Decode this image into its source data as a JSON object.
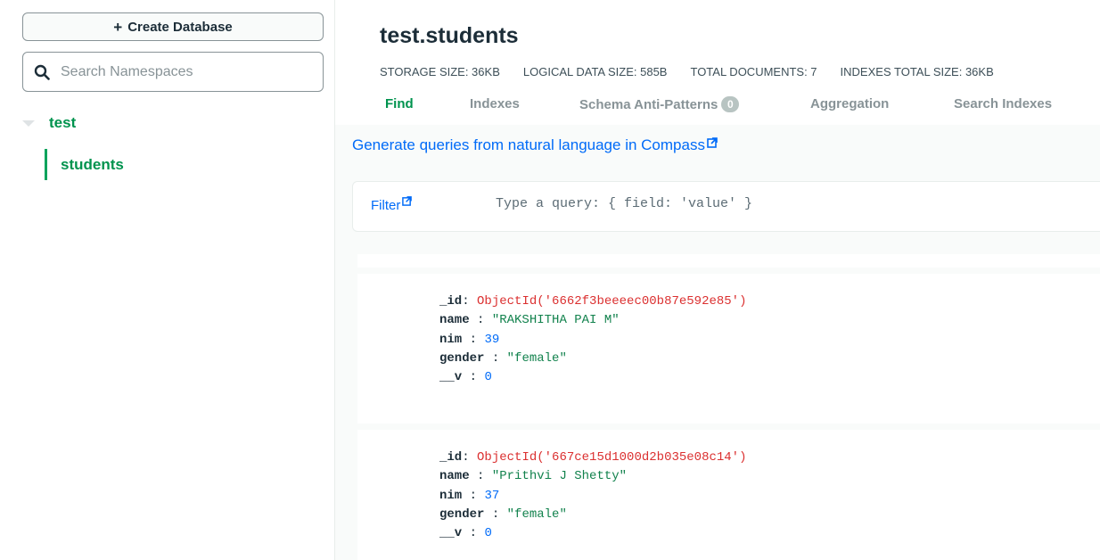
{
  "sidebar": {
    "create_label": "Create Database",
    "search_placeholder": "Search Namespaces",
    "database": "test",
    "collection": "students"
  },
  "header": {
    "title": "test.students",
    "stats": [
      "STORAGE SIZE: 36KB",
      "LOGICAL DATA SIZE: 585B",
      "TOTAL DOCUMENTS: 7",
      "INDEXES TOTAL SIZE: 36KB"
    ],
    "tabs": [
      {
        "label": "Find",
        "active": true
      },
      {
        "label": "Indexes"
      },
      {
        "label": "Schema Anti-Patterns",
        "badge": "0"
      },
      {
        "label": "Aggregation"
      },
      {
        "label": "Search Indexes"
      }
    ]
  },
  "nl_link": "Generate queries from natural language in Compass",
  "filter": {
    "label": "Filter",
    "placeholder": "Type a query: { field: 'value' }"
  },
  "documents": [
    {
      "fields": [
        {
          "key": "_id",
          "value": "ObjectId('6662f3beeeec00b87e592e85')",
          "type": "oid"
        },
        {
          "key": "name",
          "value": "\"RAKSHITHA PAI M\"",
          "type": "str"
        },
        {
          "key": "nim",
          "value": "39",
          "type": "num"
        },
        {
          "key": "gender",
          "value": "\"female\"",
          "type": "str"
        },
        {
          "key": "__v",
          "value": "0",
          "type": "num"
        }
      ]
    },
    {
      "fields": [
        {
          "key": "_id",
          "value": "ObjectId('667ce15d1000d2b035e08c14')",
          "type": "oid"
        },
        {
          "key": "name",
          "value": "\"Prithvi J Shetty\"",
          "type": "str"
        },
        {
          "key": "nim",
          "value": "37",
          "type": "num"
        },
        {
          "key": "gender",
          "value": "\"female\"",
          "type": "str"
        },
        {
          "key": "__v",
          "value": "0",
          "type": "num"
        }
      ]
    }
  ],
  "colors": {
    "accent_green": "#00934e",
    "link_blue": "#016bf8",
    "oid_red": "#db3030",
    "string_green": "#12824d"
  }
}
